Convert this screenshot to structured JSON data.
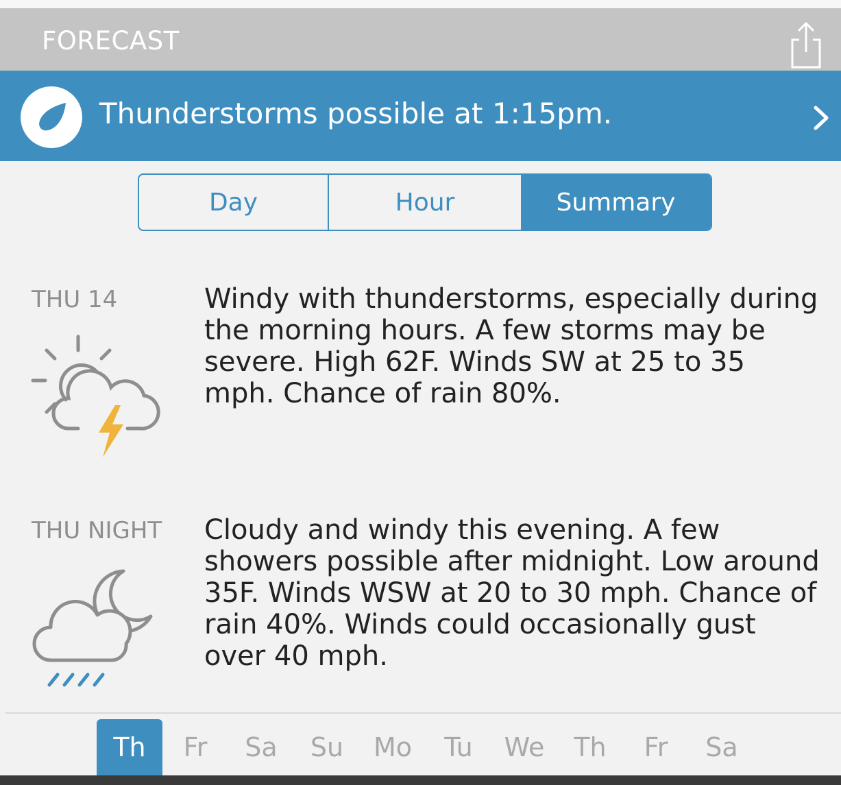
{
  "header": {
    "title": "FORECAST",
    "share_icon": "share-icon"
  },
  "alert": {
    "text": "Thunderstorms possible at 1:15pm.",
    "icon": "raindrop-icon",
    "chevron": "chevron-right-icon"
  },
  "tabs": [
    {
      "label": "Day",
      "active": false
    },
    {
      "label": "Hour",
      "active": false
    },
    {
      "label": "Summary",
      "active": true
    }
  ],
  "periods": [
    {
      "label": "THU 14",
      "icon": "partly-sunny-thunderstorm-icon",
      "text": "Windy with thunderstorms, especially during the morning hours. A few storms may be severe. High 62F. Winds SW at 25 to 35 mph. Chance of rain 80%."
    },
    {
      "label": "THU NIGHT",
      "icon": "night-cloud-rain-icon",
      "text": "Cloudy and windy this evening. A few showers possible after midnight. Low around 35F. Winds WSW at 20 to 30 mph. Chance of rain 40%. Winds could occasionally gust over 40 mph."
    }
  ],
  "days": [
    {
      "label": "Th",
      "active": true
    },
    {
      "label": "Fr",
      "active": false
    },
    {
      "label": "Sa",
      "active": false
    },
    {
      "label": "Su",
      "active": false
    },
    {
      "label": "Mo",
      "active": false
    },
    {
      "label": "Tu",
      "active": false
    },
    {
      "label": "We",
      "active": false
    },
    {
      "label": "Th",
      "active": false
    },
    {
      "label": "Fr",
      "active": false
    },
    {
      "label": "Sa",
      "active": false
    }
  ],
  "colors": {
    "accent": "#3e8ebf",
    "header_bg": "#c4c4c4",
    "lightning": "#f0b43c",
    "icon_gray": "#8e8e8e"
  }
}
